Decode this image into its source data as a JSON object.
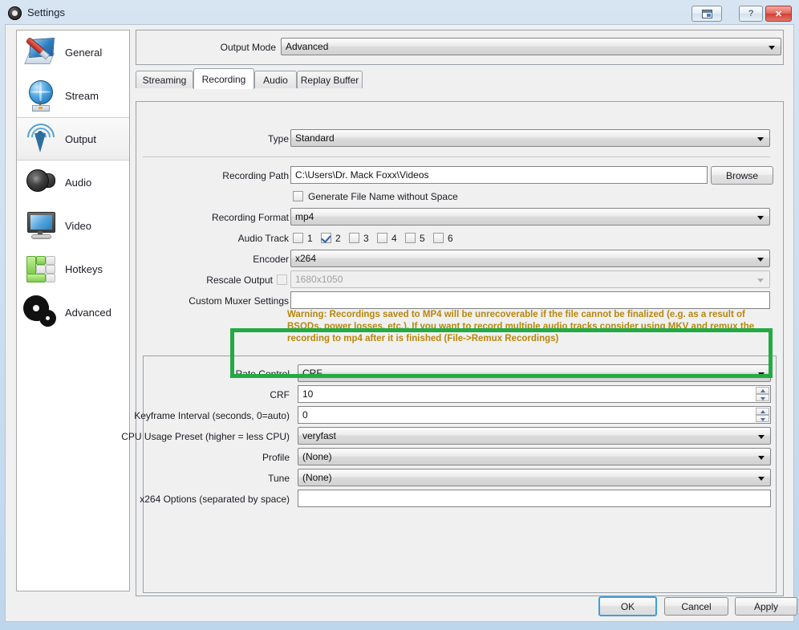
{
  "window": {
    "title": "Settings",
    "logo_icon": "obs-logo-icon",
    "controls": {
      "restore_icon": "restore-window-icon",
      "help_label": "?",
      "close_label": "✕"
    }
  },
  "sidebar": {
    "items": [
      {
        "label": "General",
        "icon": "general-icon",
        "selected": false
      },
      {
        "label": "Stream",
        "icon": "stream-icon",
        "selected": false
      },
      {
        "label": "Output",
        "icon": "output-icon",
        "selected": true
      },
      {
        "label": "Audio",
        "icon": "audio-icon",
        "selected": false
      },
      {
        "label": "Video",
        "icon": "video-icon",
        "selected": false
      },
      {
        "label": "Hotkeys",
        "icon": "hotkeys-icon",
        "selected": false
      },
      {
        "label": "Advanced",
        "icon": "advanced-icon",
        "selected": false
      }
    ]
  },
  "output_mode": {
    "label": "Output Mode",
    "value": "Advanced"
  },
  "tabs": [
    {
      "label": "Streaming",
      "active": false
    },
    {
      "label": "Recording",
      "active": true
    },
    {
      "label": "Audio",
      "active": false
    },
    {
      "label": "Replay Buffer",
      "active": false
    }
  ],
  "recording": {
    "type": {
      "label": "Type",
      "value": "Standard"
    },
    "path": {
      "label": "Recording Path",
      "value": "C:\\Users\\Dr. Mack Foxx\\Videos"
    },
    "browse_button": "Browse",
    "generate_no_space": {
      "label": "Generate File Name without Space",
      "checked": false
    },
    "format": {
      "label": "Recording Format",
      "value": "mp4"
    },
    "audio_track": {
      "label": "Audio Track",
      "tracks": [
        {
          "label": "1",
          "checked": false
        },
        {
          "label": "2",
          "checked": true
        },
        {
          "label": "3",
          "checked": false
        },
        {
          "label": "4",
          "checked": false
        },
        {
          "label": "5",
          "checked": false
        },
        {
          "label": "6",
          "checked": false
        }
      ]
    },
    "encoder": {
      "label": "Encoder",
      "value": "x264"
    },
    "rescale": {
      "label": "Rescale Output",
      "checked": false,
      "value": "1680x1050",
      "disabled": true
    },
    "muxer": {
      "label": "Custom Muxer Settings",
      "value": ""
    },
    "warning": "Warning: Recordings saved to MP4 will be unrecoverable if the file cannot be finalized (e.g. as a result of BSODs, power losses, etc.). If you want to record multiple audio tracks consider using MKV and remux the recording to mp4 after it is finished (File->Remux Recordings)"
  },
  "encoder_settings": {
    "rate_control": {
      "label": "Rate Control",
      "value": "CRF"
    },
    "crf": {
      "label": "CRF",
      "value": "10"
    },
    "keyframe_interval": {
      "label": "Keyframe Interval (seconds, 0=auto)",
      "value": "0"
    },
    "cpu_preset": {
      "label": "CPU Usage Preset (higher = less CPU)",
      "value": "veryfast"
    },
    "profile": {
      "label": "Profile",
      "value": "(None)"
    },
    "tune": {
      "label": "Tune",
      "value": "(None)"
    },
    "x264_options": {
      "label": "x264 Options (separated by space)",
      "value": ""
    }
  },
  "highlight": {
    "color": "#22aa44"
  },
  "footer": {
    "ok": "OK",
    "cancel": "Cancel",
    "apply": "Apply"
  }
}
